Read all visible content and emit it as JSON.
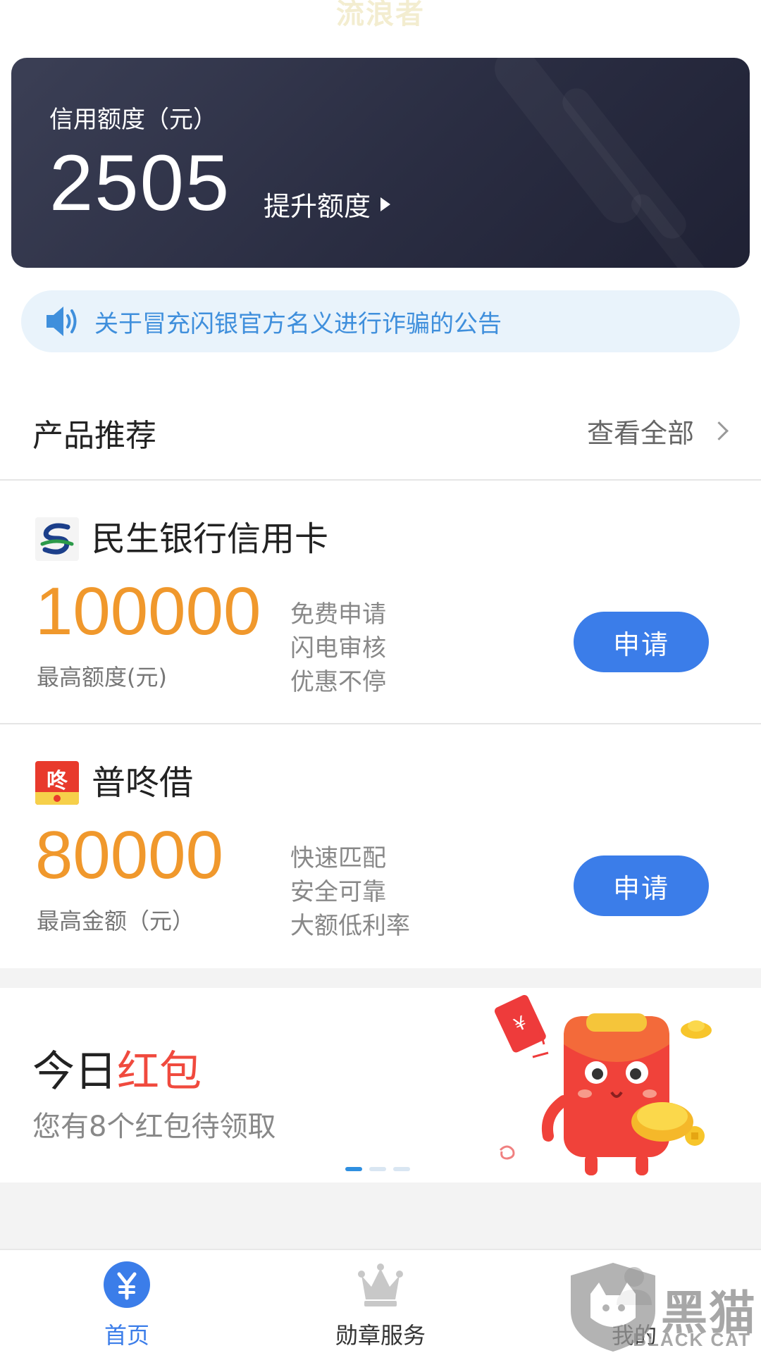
{
  "watermark_top": "流浪者",
  "credit": {
    "label": "信用额度（元）",
    "value": "2505",
    "raise_label": "提升额度"
  },
  "notice": {
    "text": "关于冒充闪银官方名义进行诈骗的公告",
    "icon": "speaker-icon"
  },
  "section": {
    "title": "产品推荐",
    "view_all": "查看全部"
  },
  "products": [
    {
      "name": "民生银行信用卡",
      "logo": "minsheng-bank-logo",
      "amount": "100000",
      "amount_label": "最高额度(元)",
      "features": [
        "免费申请",
        "闪电审核",
        "优惠不停"
      ],
      "button": "申请"
    },
    {
      "name": "普咚借",
      "logo": "pudongjie-logo",
      "amount": "80000",
      "amount_label": "最高金额（元）",
      "features": [
        "快速匹配",
        "安全可靠",
        "大额低利率"
      ],
      "button": "申请"
    }
  ],
  "banner": {
    "title_prefix": "今日",
    "title_highlight": "红包",
    "subtitle": "您有8个红包待领取",
    "pager_total": 3,
    "pager_active": 1
  },
  "tabs": [
    {
      "label": "首页",
      "icon": "yuan-icon",
      "active": true
    },
    {
      "label": "勋章服务",
      "icon": "crown-icon",
      "active": false
    },
    {
      "label": "我的",
      "icon": "profile-icon",
      "active": false
    }
  ],
  "watermark_corner": {
    "text": "黑猫",
    "sub": "BLACK CAT"
  },
  "colors": {
    "accent_blue": "#3b7de9",
    "amount_orange": "#f0982c",
    "red": "#f04a3e",
    "card_dark": "#2a2d42"
  }
}
